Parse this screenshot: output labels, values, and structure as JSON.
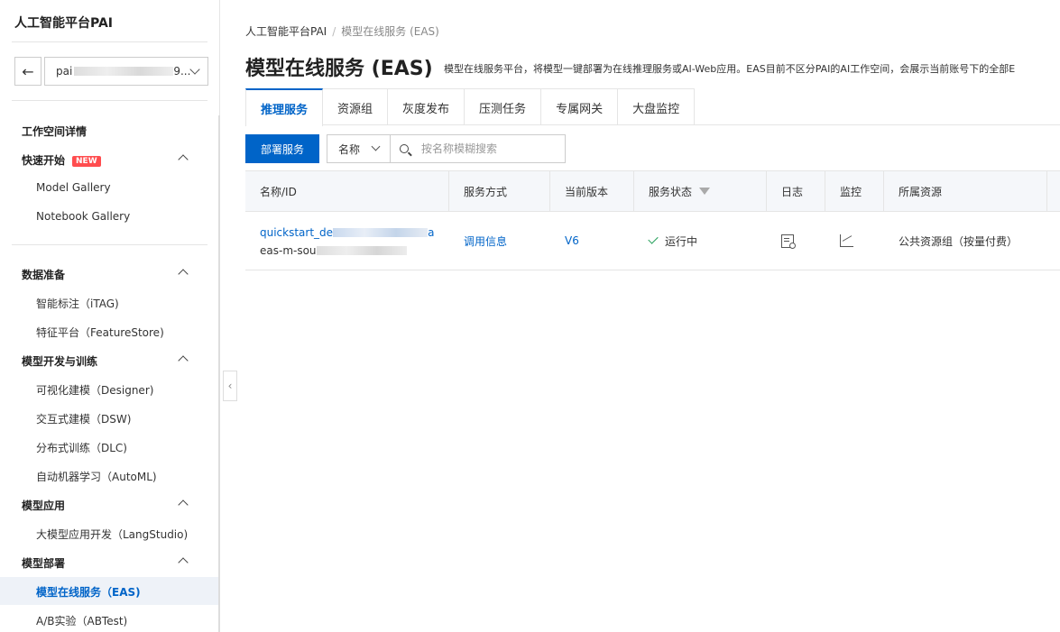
{
  "sidebar": {
    "title": "人工智能平台PAI",
    "workspace_prefix": "pai",
    "workspace_suffix": "9...",
    "detail": "工作空间详情",
    "groups": [
      {
        "label": "快速开始",
        "badge": "NEW",
        "items": [
          "Model Gallery",
          "Notebook Gallery"
        ]
      },
      {
        "label": "数据准备",
        "items": [
          "智能标注（iTAG)",
          "特征平台（FeatureStore)"
        ]
      },
      {
        "label": "模型开发与训练",
        "items": [
          "可视化建模（Designer)",
          "交互式建模（DSW)",
          "分布式训练（DLC)",
          "自动机器学习（AutoML)"
        ]
      },
      {
        "label": "模型应用",
        "items": [
          "大模型应用开发（LangStudio)"
        ]
      },
      {
        "label": "模型部署",
        "items": [
          "模型在线服务（EAS)",
          "A/B实验（ABTest)"
        ]
      }
    ]
  },
  "breadcrumb": {
    "root": "人工智能平台PAI",
    "sep": "/",
    "current": "模型在线服务 (EAS)"
  },
  "page": {
    "title": "模型在线服务 (EAS)",
    "description": "模型在线服务平台，将模型一键部署为在线推理服务或AI-Web应用。EAS目前不区分PAI的AI工作空间，会展示当前账号下的全部E"
  },
  "tabs": [
    "推理服务",
    "资源组",
    "灰度发布",
    "压测任务",
    "专属网关",
    "大盘监控"
  ],
  "toolbar": {
    "deploy_label": "部署服务",
    "field_label": "名称",
    "search_placeholder": "按名称模糊搜索"
  },
  "table": {
    "headers": [
      "名称/ID",
      "服务方式",
      "当前版本",
      "服务状态",
      "日志",
      "监控",
      "所属资源"
    ],
    "rows": [
      {
        "name_prefix": "quickstart_de",
        "name_suffix": "a",
        "id_prefix": "eas-m-sou",
        "method": "调用信息",
        "version": "V6",
        "status": "运行中",
        "resource": "公共资源组（按量付费）"
      }
    ]
  }
}
